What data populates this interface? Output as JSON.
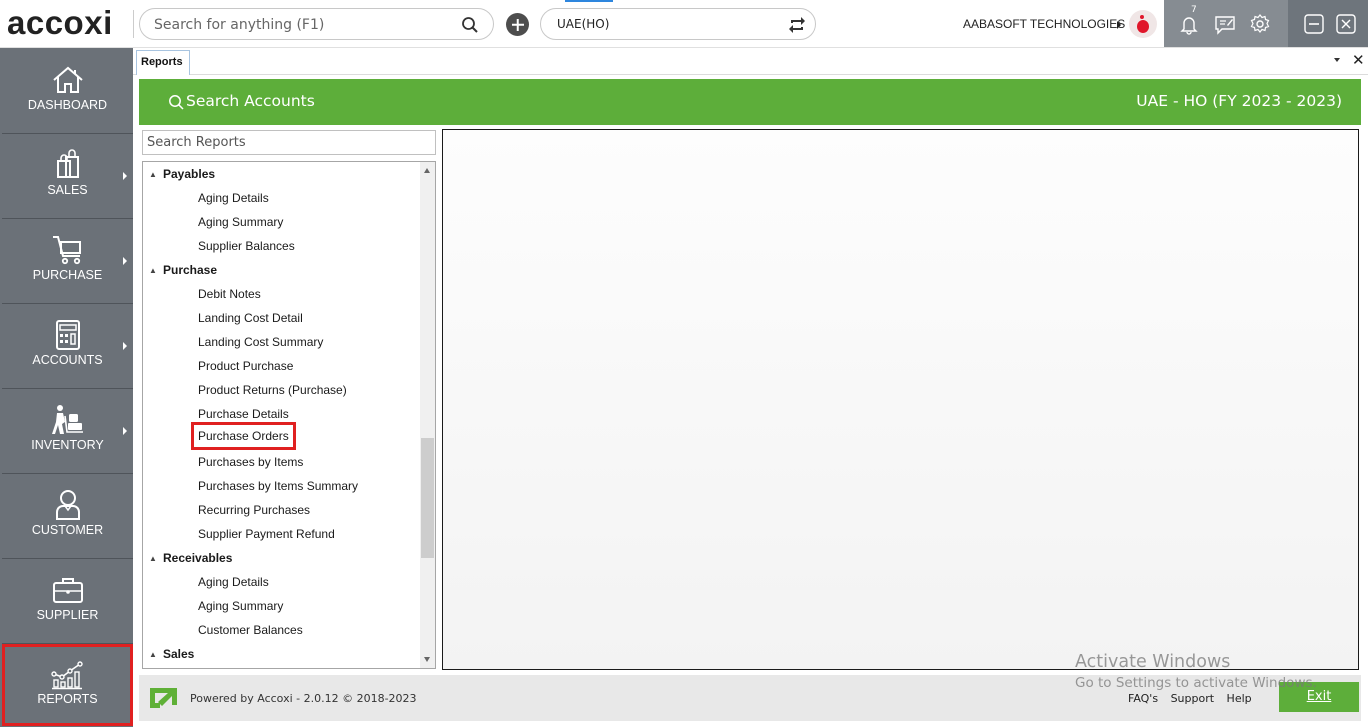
{
  "app": {
    "logo_text": "accoxi",
    "search_placeholder": "Search for anything (F1)",
    "branch_value": "UAE(HO)",
    "company_name": "AABASOFT TECHNOLOGIES",
    "notification_count": "7"
  },
  "sidebar": {
    "items": [
      {
        "label": "DASHBOARD",
        "icon": "home-icon",
        "has_submenu": false
      },
      {
        "label": "SALES",
        "icon": "shopping-bag-icon",
        "has_submenu": true
      },
      {
        "label": "PURCHASE",
        "icon": "cart-icon",
        "has_submenu": true
      },
      {
        "label": "ACCOUNTS",
        "icon": "calculator-icon",
        "has_submenu": true
      },
      {
        "label": "INVENTORY",
        "icon": "inventory-worker-icon",
        "has_submenu": true
      },
      {
        "label": "CUSTOMER",
        "icon": "user-icon",
        "has_submenu": false
      },
      {
        "label": "SUPPLIER",
        "icon": "briefcase-icon",
        "has_submenu": false
      },
      {
        "label": "REPORTS",
        "icon": "chart-icon",
        "has_submenu": false,
        "active": true
      }
    ]
  },
  "tabs": [
    {
      "label": "Reports",
      "active": true
    }
  ],
  "header": {
    "search_accounts_label": "Search Accounts",
    "fiscal_label": "UAE - HO (FY 2023 - 2023)"
  },
  "reports": {
    "search_placeholder": "Search Reports",
    "tree": [
      {
        "type": "group",
        "label": "Payables",
        "expanded": true
      },
      {
        "type": "leaf",
        "label": "Aging Details"
      },
      {
        "type": "leaf",
        "label": "Aging Summary"
      },
      {
        "type": "leaf",
        "label": "Supplier Balances"
      },
      {
        "type": "group",
        "label": "Purchase",
        "expanded": true
      },
      {
        "type": "leaf",
        "label": "Debit Notes"
      },
      {
        "type": "leaf",
        "label": "Landing Cost Detail"
      },
      {
        "type": "leaf",
        "label": "Landing Cost Summary"
      },
      {
        "type": "leaf",
        "label": "Product Purchase"
      },
      {
        "type": "leaf",
        "label": "Product Returns (Purchase)"
      },
      {
        "type": "leaf",
        "label": "Purchase Details"
      },
      {
        "type": "leaf",
        "label": "Purchase Orders",
        "highlighted": true
      },
      {
        "type": "leaf",
        "label": "Purchases by Items"
      },
      {
        "type": "leaf",
        "label": "Purchases by Items Summary"
      },
      {
        "type": "leaf",
        "label": "Recurring Purchases"
      },
      {
        "type": "leaf",
        "label": "Supplier Payment Refund"
      },
      {
        "type": "group",
        "label": "Receivables",
        "expanded": true
      },
      {
        "type": "leaf",
        "label": "Aging Details"
      },
      {
        "type": "leaf",
        "label": "Aging Summary"
      },
      {
        "type": "leaf",
        "label": "Customer Balances"
      },
      {
        "type": "group",
        "label": "Sales",
        "expanded": true
      }
    ]
  },
  "footer": {
    "powered_by": "Powered by Accoxi - 2.0.12 © 2018-2023",
    "links": [
      "FAQ's",
      "Support",
      "Help"
    ],
    "exit_label": "Exit"
  },
  "watermark": {
    "line1": "Activate Windows",
    "line2": "Go to Settings to activate Windows."
  },
  "colors": {
    "brand_green": "#5dae3a",
    "sidebar_bg": "#6b7178",
    "highlight_red": "#e02020"
  }
}
